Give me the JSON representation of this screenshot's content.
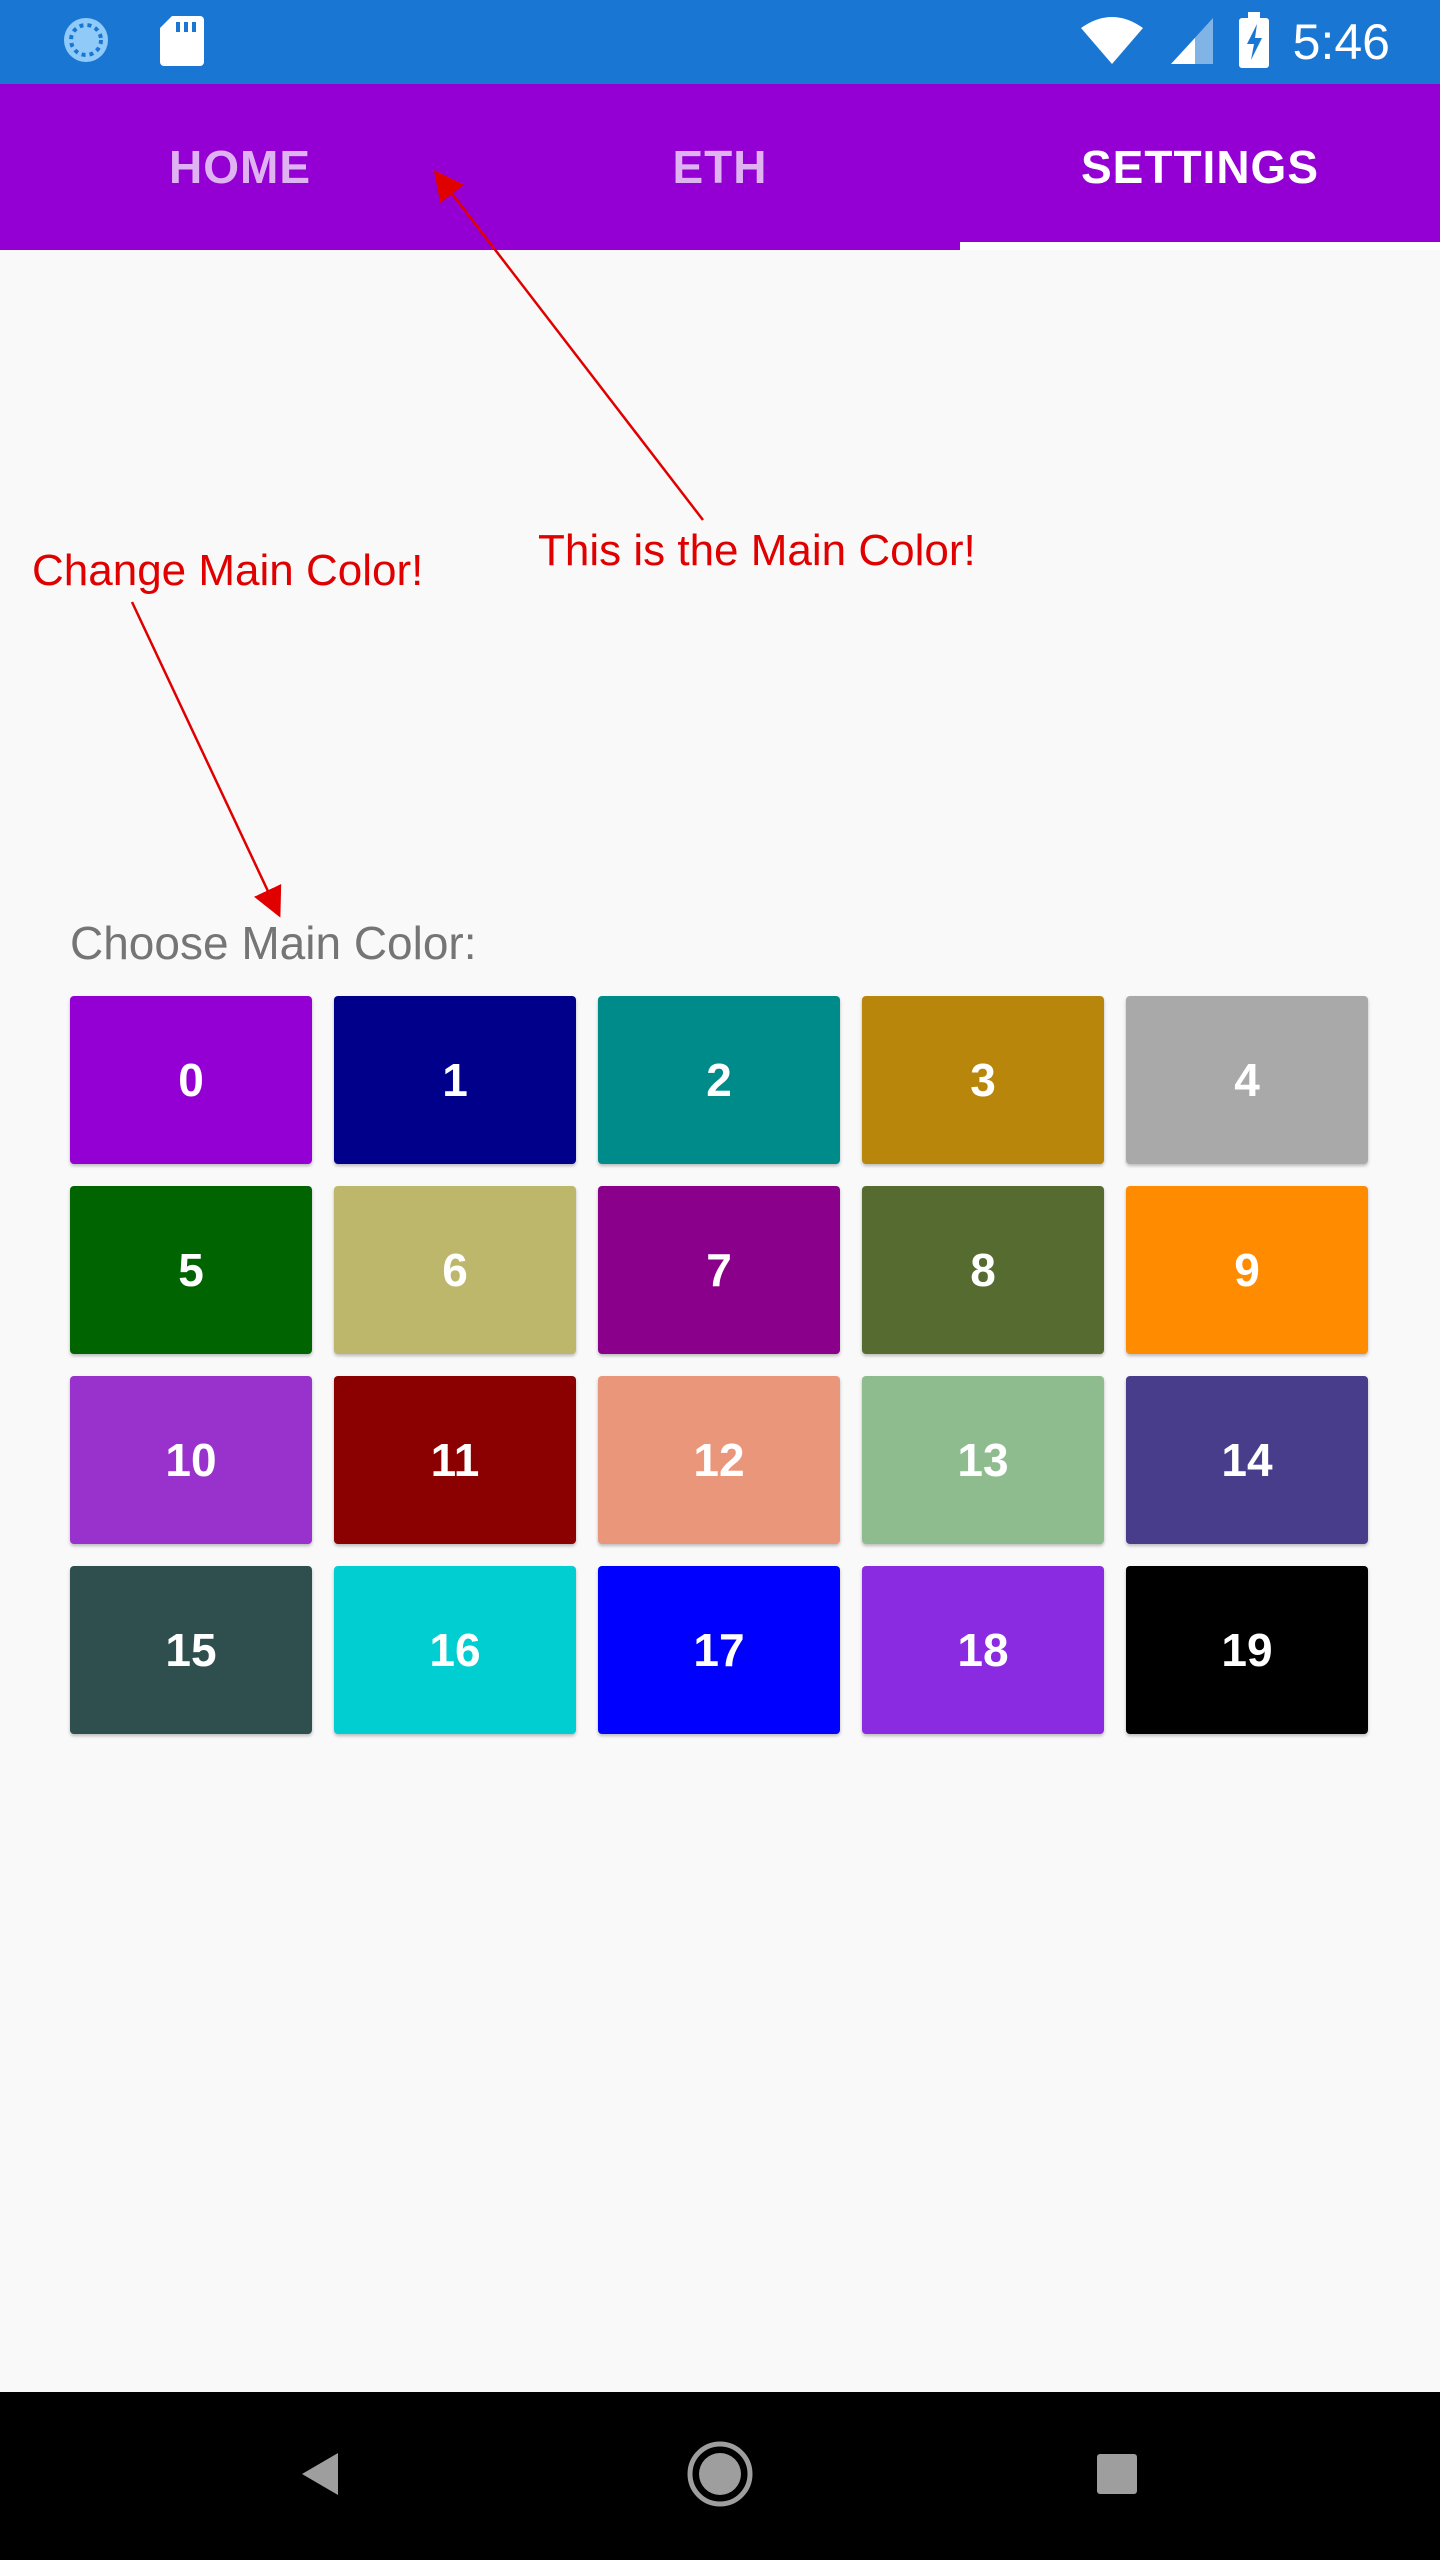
{
  "status_bar": {
    "time": "5:46",
    "icons": [
      "sync-icon",
      "sd-card-icon",
      "wifi-icon",
      "cell-signal-icon",
      "battery-charging-icon"
    ],
    "background": "#1976d2"
  },
  "tabs": [
    {
      "label": "HOME",
      "active": false
    },
    {
      "label": "ETH",
      "active": false
    },
    {
      "label": "SETTINGS",
      "active": true
    }
  ],
  "tab_bar_color": "#9400d3",
  "annotations": {
    "main_color_note": "This is the Main Color!",
    "change_color_note": "Change Main Color!",
    "color": "#e00000"
  },
  "chooser": {
    "label": "Choose Main Color:",
    "swatches": [
      {
        "label": "0",
        "color": "#9400d3"
      },
      {
        "label": "1",
        "color": "#00008b"
      },
      {
        "label": "2",
        "color": "#008b8b"
      },
      {
        "label": "3",
        "color": "#b8860b"
      },
      {
        "label": "4",
        "color": "#a9a9a9"
      },
      {
        "label": "5",
        "color": "#006400"
      },
      {
        "label": "6",
        "color": "#bdb76b"
      },
      {
        "label": "7",
        "color": "#8b008b"
      },
      {
        "label": "8",
        "color": "#556b2f"
      },
      {
        "label": "9",
        "color": "#ff8c00"
      },
      {
        "label": "10",
        "color": "#9932cc"
      },
      {
        "label": "11",
        "color": "#8b0000"
      },
      {
        "label": "12",
        "color": "#e9967a"
      },
      {
        "label": "13",
        "color": "#8fbc8f"
      },
      {
        "label": "14",
        "color": "#483d8b"
      },
      {
        "label": "15",
        "color": "#2f4f4f"
      },
      {
        "label": "16",
        "color": "#00ced1"
      },
      {
        "label": "17",
        "color": "#0000ff"
      },
      {
        "label": "18",
        "color": "#8a2be2"
      },
      {
        "label": "19",
        "color": "#000000"
      }
    ]
  },
  "nav_bar": {
    "buttons": [
      "back-icon",
      "home-icon",
      "recents-icon"
    ]
  }
}
